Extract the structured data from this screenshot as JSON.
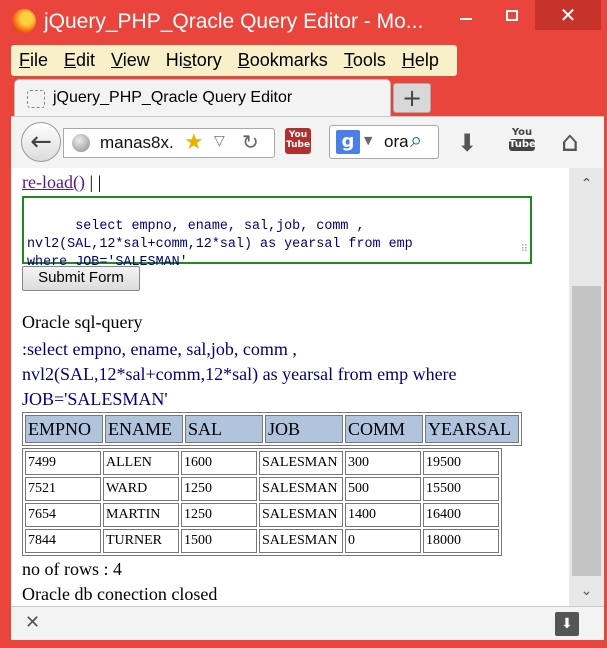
{
  "window": {
    "title": "jQuery_PHP_Qracle Query Editor - Mo...",
    "minimize": "",
    "maximize": "",
    "close": "✕"
  },
  "menu": [
    {
      "acc": "F",
      "rest": "ile"
    },
    {
      "acc": "E",
      "rest": "dit"
    },
    {
      "acc": "V",
      "rest": "iew"
    },
    {
      "pre": "Hi",
      "acc": "s",
      "rest": "tory"
    },
    {
      "acc": "B",
      "rest": "ookmarks"
    },
    {
      "acc": "T",
      "rest": "ools"
    },
    {
      "acc": "H",
      "rest": "elp"
    }
  ],
  "tab": {
    "title": "jQuery_PHP_Qracle Query Editor",
    "new_tab": "+"
  },
  "nav": {
    "url": "manas8x.",
    "search_text": "ora",
    "yt_small": "You Tube",
    "yt_big_top": "You",
    "yt_big_bottom": "Tube",
    "icons": [
      "back-arrow-icon",
      "globe-icon",
      "star-icon",
      "reload-icon",
      "google-icon",
      "search-icon",
      "download-arrow-icon",
      "home-icon"
    ]
  },
  "page": {
    "reload_link": "re-load()",
    "reload_sep": "| |",
    "query_text": "select empno, ename, sal,job, comm ,\nnvl2(SAL,12*sal+comm,12*sal) as yearsal from emp\nwhere JOB='SALESMAN'",
    "submit_label": "Submit Form",
    "heading": "Oracle sql-query",
    "sql_echo": ":select empno, ename, sal,job, comm , nvl2(SAL,12*sal+comm,12*sal) as yearsal from emp where JOB='SALESMAN'",
    "columns": [
      "EMPNO",
      "ENAME",
      "SAL",
      "JOB",
      "COMM",
      "YEARSAL"
    ],
    "rows": [
      [
        "7499",
        "ALLEN",
        "1600",
        "SALESMAN",
        "300",
        "19500"
      ],
      [
        "7521",
        "WARD",
        "1250",
        "SALESMAN",
        "500",
        "15500"
      ],
      [
        "7654",
        "MARTIN",
        "1250",
        "SALESMAN",
        "1400",
        "16400"
      ],
      [
        "7844",
        "TURNER",
        "1500",
        "SALESMAN",
        "0",
        "18000"
      ]
    ],
    "row_count": "no of rows : 4",
    "closed_msg": "Oracle db conection closed"
  },
  "colors": {
    "titlebar": "#e9453c",
    "menubar": "#f7f0c8",
    "query_border": "#1f8a1f",
    "query_text": "#000080",
    "header_cell": "#b0c4de"
  }
}
